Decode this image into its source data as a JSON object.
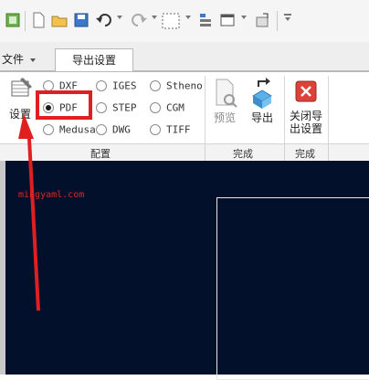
{
  "toolbar": {
    "icons": [
      "app-icon",
      "new-file-icon",
      "open-folder-icon",
      "save-icon",
      "undo-icon",
      "redo-icon",
      "select-box-icon",
      "settings-icon",
      "window-icon",
      "switch-window-icon",
      "customize-icon"
    ]
  },
  "tabs": {
    "file": "文件",
    "export_settings": "导出设置"
  },
  "ribbon": {
    "settings_label": "设置",
    "formats": [
      {
        "label": "DXF",
        "selected": false
      },
      {
        "label": "PDF",
        "selected": true
      },
      {
        "label": "Medusa",
        "selected": false
      },
      {
        "label": "IGES",
        "selected": false
      },
      {
        "label": "STEP",
        "selected": false
      },
      {
        "label": "DWG",
        "selected": false
      },
      {
        "label": "Stheno",
        "selected": false
      },
      {
        "label": "CGM",
        "selected": false
      },
      {
        "label": "TIFF",
        "selected": false
      }
    ],
    "preview_label": "预览",
    "export_label": "导出",
    "close_label_1": "关闭导",
    "close_label_2": "出设置",
    "group_config": "配置",
    "group_finish": "完成",
    "group_finish_2": "完成"
  },
  "watermark": "mingyaml.com",
  "colors": {
    "canvas_bg": "#02102b",
    "highlight": "#e02020",
    "arrow": "#e02020"
  }
}
